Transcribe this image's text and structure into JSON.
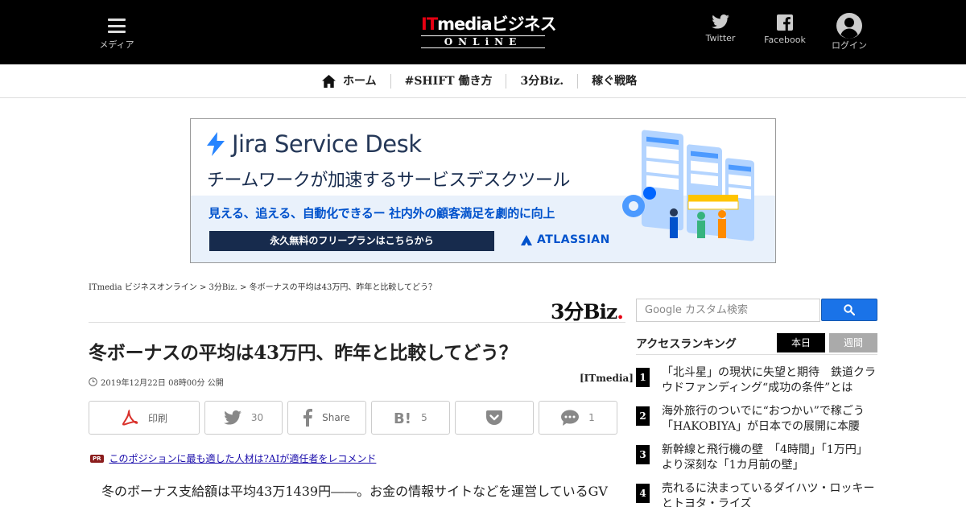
{
  "header": {
    "menu_label": "メディア",
    "logo_top_it": "IT",
    "logo_top_rest": "mediaビジネス",
    "logo_bottom": "ONLiNE",
    "twitter_label": "Twitter",
    "facebook_label": "Facebook",
    "login_label": "ログイン"
  },
  "nav": {
    "items": [
      {
        "label": "ホーム",
        "icon": "home-icon"
      },
      {
        "label": "#SHIFT 働き方"
      },
      {
        "label": "3分Biz."
      },
      {
        "label": "稼ぐ戦略"
      }
    ]
  },
  "ad": {
    "brand": "Jira Service Desk",
    "tagline": "チームワークが加速するサービスデスクツール",
    "subline": "見える、追える、自動化できるー 社内外の顧客満足を劇的に向上",
    "cta": "永久無料のフリープランはこちらから",
    "vendor": "ATLASSIAN",
    "colors": {
      "brand_blue": "#0052cc",
      "navy": "#172b4d",
      "band": "#e9f1fb"
    }
  },
  "breadcrumb": "ITmedia ビジネスオンライン > 3分Biz. > 冬ボーナスの平均は43万円、昨年と比較してどう？",
  "article": {
    "section_logo": "3分Biz",
    "section_logo_dot": ".",
    "title": "冬ボーナスの平均は43万円、昨年と比較してどう？",
    "date": "2019年12月22日 08時00分 公開",
    "source": "[ITmedia]",
    "share": {
      "print_label": "印刷",
      "twitter_count": "30",
      "facebook_label": "Share",
      "hatena_count": "5",
      "pocket_label": "",
      "comment_count": "1"
    },
    "pr_badge": "PR",
    "pr_link": "このポジションに最も適した人材は?AIが適任者をレコメンド",
    "lead": "冬のボーナス支給額は平均43万1439円――。お金の情報サイトなどを運営しているGV"
  },
  "sidebar": {
    "search_placeholder": "Google カスタム検索",
    "ranking_title": "アクセスランキング",
    "tab_daily": "本日",
    "tab_weekly": "週間",
    "ranking": [
      {
        "rank": "1",
        "text": "「北斗星」の現状に失望と期待　鉄道クラウドファンディング“成功の条件”とは"
      },
      {
        "rank": "2",
        "text": "海外旅行のついでに“おつかい”で稼ごう　「HAKOBIYA」が日本での展開に本腰"
      },
      {
        "rank": "3",
        "text": "新幹線と飛行機の壁　「4時間」「1万円」より深刻な「1カ月前の壁」"
      },
      {
        "rank": "4",
        "text": "売れるに決まっているダイハツ・ロッキーとトヨタ・ライズ"
      }
    ]
  }
}
